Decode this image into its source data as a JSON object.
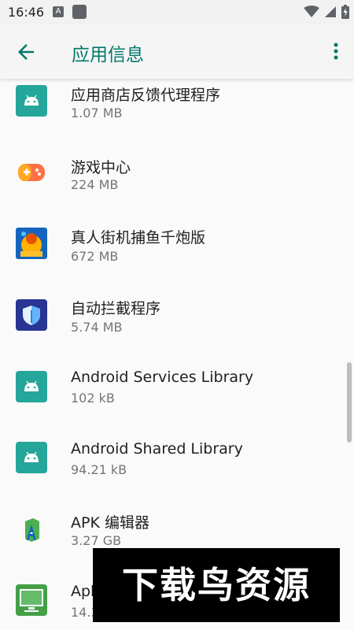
{
  "status_bar": {
    "time": "16:46",
    "notification_letter": "A"
  },
  "app_bar": {
    "title": "应用信息"
  },
  "apps": [
    {
      "name": "应用商店反馈代理程序",
      "size": "1.07 MB",
      "icon": "android-icon"
    },
    {
      "name": "游戏中心",
      "size": "224 MB",
      "icon": "game-center-icon"
    },
    {
      "name": "真人街机捕鱼千炮版",
      "size": "672 MB",
      "icon": "fishing-game-icon"
    },
    {
      "name": "自动拦截程序",
      "size": "5.74 MB",
      "icon": "shield-icon"
    },
    {
      "name": "Android Services Library",
      "size": "102 kB",
      "icon": "android-icon"
    },
    {
      "name": "Android Shared Library",
      "size": "94.21 kB",
      "icon": "android-icon"
    },
    {
      "name": "APK 编辑器",
      "size": "3.27 GB",
      "icon": "apk-editor-icon"
    },
    {
      "name": "Apk",
      "size": "14.3",
      "icon": "apk-installer-icon"
    }
  ],
  "watermark": {
    "text": "下载鸟资源"
  },
  "colors": {
    "accent": "#00796b",
    "android_bg": "#26a69a"
  }
}
